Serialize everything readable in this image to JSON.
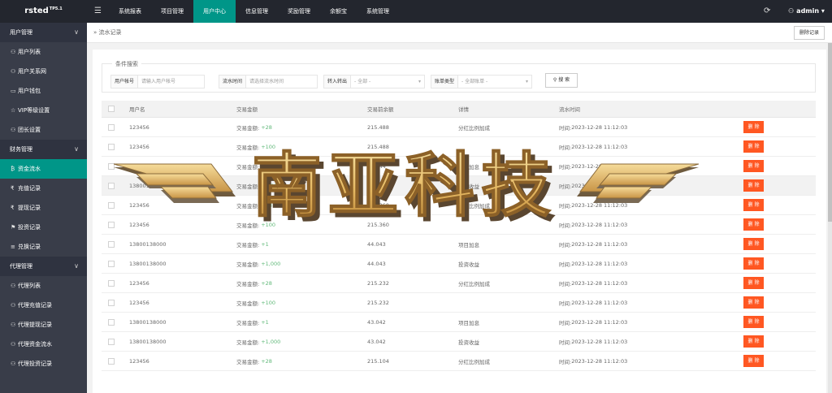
{
  "brand": {
    "name": "rsted",
    "version": "TP5.1"
  },
  "topnav": {
    "items": [
      {
        "label": "系统报表"
      },
      {
        "label": "项目管理"
      },
      {
        "label": "用户中心"
      },
      {
        "label": "信息管理"
      },
      {
        "label": "奖励管理"
      },
      {
        "label": "余额宝"
      },
      {
        "label": "系统管理"
      }
    ],
    "active_label": "用户中心",
    "user": "admin"
  },
  "sidebar": {
    "groups": [
      {
        "label": "用户管理",
        "items": [
          {
            "label": "用户列表",
            "icon": "user-icon"
          },
          {
            "label": "用户关系网",
            "icon": "user-icon"
          },
          {
            "label": "用户钱包",
            "icon": "wallet-icon"
          },
          {
            "label": "VIP等级设置",
            "icon": "star-icon"
          },
          {
            "label": "团长设置",
            "icon": "user-icon"
          }
        ]
      },
      {
        "label": "财务管理",
        "items": [
          {
            "label": "资金流水",
            "icon": "bitcoin-icon"
          },
          {
            "label": "充值记录",
            "icon": "rupee-icon"
          },
          {
            "label": "提现记录",
            "icon": "rupee-icon"
          },
          {
            "label": "投资记录",
            "icon": "flag-icon"
          },
          {
            "label": "兑换记录",
            "icon": "list-icon"
          }
        ]
      },
      {
        "label": "代理管理",
        "items": [
          {
            "label": "代理列表",
            "icon": "user-icon"
          },
          {
            "label": "代理充值记录",
            "icon": "user-icon"
          },
          {
            "label": "代理提现记录",
            "icon": "user-icon"
          },
          {
            "label": "代理资金流水",
            "icon": "user-icon"
          },
          {
            "label": "代理投资记录",
            "icon": "user-icon"
          }
        ]
      }
    ],
    "active_item": "资金流水"
  },
  "tabbar": {
    "tab_label": "流水记录",
    "delete_records_label": "删除记录"
  },
  "filter": {
    "legend": "条件搜索",
    "user_label": "用户帐号",
    "user_placeholder": "请输入用户帐号",
    "time_label": "流水时间",
    "time_placeholder": "请选择流水时间",
    "inout_label": "转入转出",
    "inout_value": "- 全部 -",
    "type_label": "账单类型",
    "type_value": "- 全部账单 -",
    "search_label": "搜 索"
  },
  "table": {
    "headers": [
      "用户名",
      "交易金额",
      "交易前余额",
      "详情",
      "流水时间"
    ],
    "amount_prefix": "交易金额:",
    "time_prefix": "时间:",
    "delete_label": "删 除",
    "rows": [
      {
        "user": "123456",
        "amount": "+28",
        "before": "215.488",
        "detail": "分红比例加成",
        "time": "2023-12-28 11:12:03"
      },
      {
        "user": "123456",
        "amount": "+100",
        "before": "215.488",
        "detail": "",
        "time": "2023-12-28 11:12:03"
      },
      {
        "user": "13800138000",
        "amount": "+1",
        "before": "45.044",
        "detail": "项目加息",
        "time": "2023-12-28 11:12:03"
      },
      {
        "user": "13800138000",
        "amount": "+1,000",
        "before": "45.044",
        "detail": "投资收益",
        "time": "2023-12-28 11:12:03"
      },
      {
        "user": "123456",
        "amount": "+28",
        "before": "215.360",
        "detail": "分红比例加成",
        "time": "2023-12-28 11:12:03"
      },
      {
        "user": "123456",
        "amount": "+100",
        "before": "215.360",
        "detail": "",
        "time": "2023-12-28 11:12:03"
      },
      {
        "user": "13800138000",
        "amount": "+1",
        "before": "44.043",
        "detail": "项目加息",
        "time": "2023-12-28 11:12:03"
      },
      {
        "user": "13800138000",
        "amount": "+1,000",
        "before": "44.043",
        "detail": "投资收益",
        "time": "2023-12-28 11:12:03"
      },
      {
        "user": "123456",
        "amount": "+28",
        "before": "215.232",
        "detail": "分红比例加成",
        "time": "2023-12-28 11:12:03"
      },
      {
        "user": "123456",
        "amount": "+100",
        "before": "215.232",
        "detail": "",
        "time": "2023-12-28 11:12:03"
      },
      {
        "user": "13800138000",
        "amount": "+1",
        "before": "43.042",
        "detail": "项目加息",
        "time": "2023-12-28 11:12:03"
      },
      {
        "user": "13800138000",
        "amount": "+1,000",
        "before": "43.042",
        "detail": "投资收益",
        "time": "2023-12-28 11:12:03"
      },
      {
        "user": "123456",
        "amount": "+28",
        "before": "215.104",
        "detail": "分红比例加成",
        "time": "2023-12-28 11:12:03"
      }
    ],
    "highlight_row": 3
  },
  "watermark": {
    "text": "南亚科技"
  },
  "colors": {
    "accent": "#009688",
    "topbar": "#23262e",
    "sidebar": "#393d49",
    "delete": "#ff5722",
    "amount": "#5fb878"
  }
}
